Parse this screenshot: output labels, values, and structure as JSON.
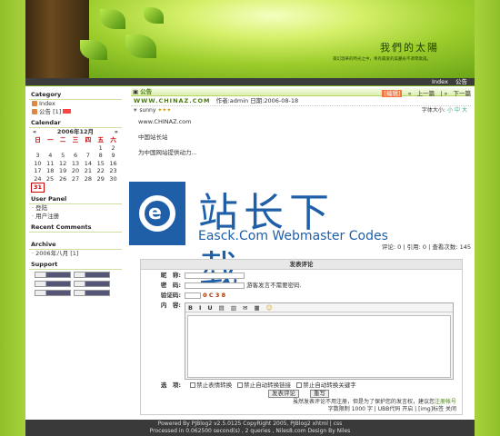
{
  "header": {
    "title": "我們的太陽",
    "desc": "夜幻溫華的時光之中，青有最爱的美麗永不凋零歌謠。"
  },
  "topnav": {
    "index": "Index",
    "notice": "公告"
  },
  "sidebar": {
    "category_title": "Category",
    "category_items": [
      {
        "label": "Index"
      },
      {
        "label": "公告 [1]"
      }
    ],
    "calendar_title": "Calendar",
    "calendar_month": "2006年12月",
    "weekdays": [
      "日",
      "一",
      "二",
      "三",
      "四",
      "五",
      "六"
    ],
    "weeks": [
      [
        "",
        "",
        "",
        "",
        "",
        "1",
        "2"
      ],
      [
        "3",
        "4",
        "5",
        "6",
        "7",
        "8",
        "9"
      ],
      [
        "10",
        "11",
        "12",
        "13",
        "14",
        "15",
        "16"
      ],
      [
        "17",
        "18",
        "19",
        "20",
        "21",
        "22",
        "23"
      ],
      [
        "24",
        "25",
        "26",
        "27",
        "28",
        "29",
        "30"
      ],
      [
        "31",
        "",
        "",
        "",
        "",
        "",
        ""
      ]
    ],
    "userpanel_title": "User Panel",
    "userpanel_items": [
      "登陆",
      "用户注册"
    ],
    "recent_title": "Recent Comments",
    "archive_title": "Archive",
    "archive_items": [
      "2006年八月 [1]"
    ],
    "support_title": "Support"
  },
  "post": {
    "category": "公告",
    "actions": {
      "edit": "[编辑]",
      "prev": "上一篇",
      "next": "下一篇"
    },
    "title": "WWW.CHINAZ.COM",
    "meta": "作者:admin 日期:2006-08-18",
    "rating_label": "sunny",
    "font_size": "字体大小:",
    "sizes": [
      "小",
      "中",
      "大"
    ],
    "body": [
      "www.CHINAZ.com",
      "中国站长站",
      "为中国网站提供动力..."
    ],
    "stats": "评论: 0 | 引用: 0 | 查看次数: 145"
  },
  "watermark": {
    "cn": "站长下载",
    "en": "Easck.Com Webmaster Codes"
  },
  "comment": {
    "title": "发表评论",
    "nick_label": "昵　称:",
    "pass_label": "密　码:",
    "pass_hint": "游客发言不需要密码.",
    "verify_label": "验证码:",
    "verify_code": "0 C 3 8",
    "content_label": "内　容:",
    "toolbar": [
      "B",
      "I",
      "U"
    ],
    "options_label": "选　项:",
    "options": [
      "禁止表情转换",
      "禁止自动转换链接",
      "禁止自动转换关键字"
    ],
    "submit": "发表评论",
    "reset": "重写",
    "note1": "虽然发表评论不用注册，但是为了保护您的发言权，建议您",
    "note_link": "注册帐号",
    "note2": "字数限制 1000 字 | UBB代码 开启 | [img]标签 关闭"
  },
  "footer": {
    "line1": "Powered By PJBlog2 v2.5.0125 CopyRight 2005, PJBlog2 xhtml | css",
    "line2": "Processed in 0.062500 second(s) , 2 queries , Niles8.com Design By Niles"
  }
}
